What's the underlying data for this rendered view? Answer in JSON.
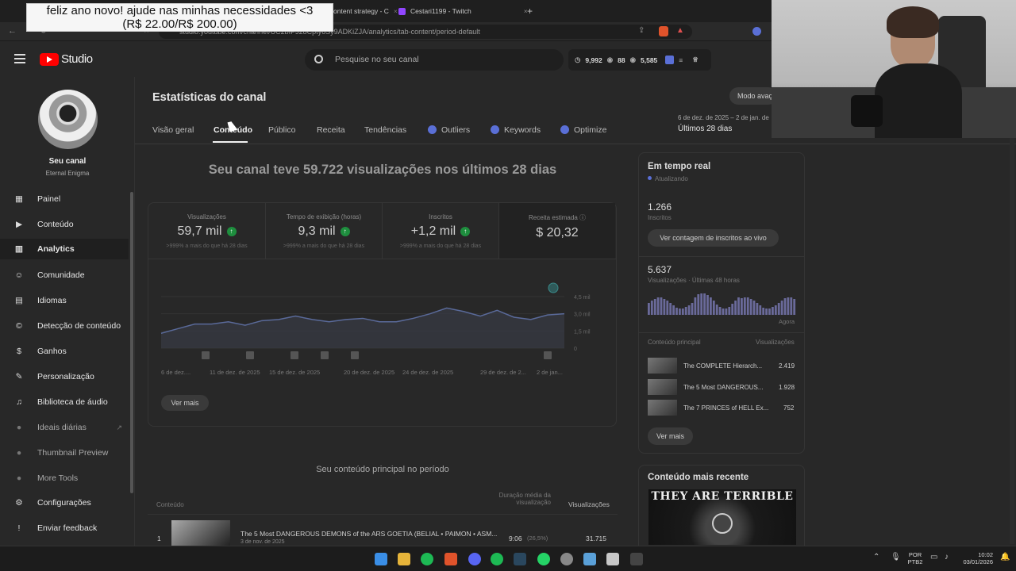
{
  "browser": {
    "tabs": [
      {
        "label": "ontent strategy - C"
      },
      {
        "label": "Cestari1199 - Twitch"
      }
    ],
    "url": "studio.youtube.com/channel/UC2bIPJ28Cpty6Sy9ADKiZJA/analytics/tab-content/period-default"
  },
  "overlay": {
    "donation_line1": "feliz ano novo! ajude nas minhas necessidades <3",
    "donation_line2": "(R$ 22.00/R$ 200.00)"
  },
  "header": {
    "logo_text": "Studio",
    "search_placeholder": "Pesquise no seu canal",
    "stat1": "9,992",
    "stat2": "88",
    "stat3": "5,585"
  },
  "sidebar": {
    "channel_label": "Seu canal",
    "channel_name": "Eternal Enigma",
    "items": [
      {
        "label": "Painel",
        "icon": "dashboard-icon"
      },
      {
        "label": "Conteúdo",
        "icon": "content-icon"
      },
      {
        "label": "Analytics",
        "icon": "analytics-icon"
      },
      {
        "label": "Comunidade",
        "icon": "community-icon"
      },
      {
        "label": "Idiomas",
        "icon": "subtitles-icon"
      },
      {
        "label": "Detecção de conteúdo",
        "icon": "copyright-icon"
      },
      {
        "label": "Ganhos",
        "icon": "dollar-icon"
      },
      {
        "label": "Personalização",
        "icon": "customize-icon"
      },
      {
        "label": "Biblioteca de áudio",
        "icon": "audio-icon"
      },
      {
        "label": "Ideais diárias",
        "icon": "extension-icon"
      },
      {
        "label": "Thumbnail Preview",
        "icon": "extension-icon"
      },
      {
        "label": "More Tools",
        "icon": "extension-icon"
      }
    ],
    "footer": [
      {
        "label": "Configurações",
        "icon": "gear-icon"
      },
      {
        "label": "Enviar feedback",
        "icon": "feedback-icon"
      }
    ]
  },
  "main": {
    "title": "Estatísticas do canal",
    "mode_button": "Modo avaç",
    "date_range": "6 de dez. de 2025 – 2 de jan. de",
    "period_label": "Últimos 28 dias",
    "tabs": [
      "Visão geral",
      "Conteúdo",
      "Público",
      "Receita",
      "Tendências",
      "Outliers",
      "Keywords",
      "Optimize"
    ],
    "headline": "Seu canal teve 59.722 visualizações nos últimos 28 dias",
    "metrics": [
      {
        "label": "Visualizações",
        "value": "59,7 mil",
        "sub": ">999% a mais do que há 28 dias"
      },
      {
        "label": "Tempo de exibição (horas)",
        "value": "9,3 mil",
        "sub": ">999% a mais do que há 28 dias"
      },
      {
        "label": "Inscritos",
        "value": "+1,2 mil",
        "sub": ">999% a mais do que há 28 dias"
      },
      {
        "label": "Receita estimada",
        "value": "$ 20,32",
        "sub": ""
      }
    ],
    "chart_ylabels": [
      "4,5 mil",
      "3,0 mil",
      "1,5 mil",
      "0"
    ],
    "chart_xlabels": [
      "6 de dez....",
      "11 de dez. de 2025",
      "15 de dez. de 2025",
      "20 de dez. de 2025",
      "24 de dez. de 2025",
      "29 de dez. de 2...",
      "2 de jan..."
    ],
    "see_more": "Ver mais",
    "top_content_title": "Seu conteúdo principal no período",
    "table_headers": {
      "content": "Conteúdo",
      "avg": "Duração média da visualização",
      "views": "Visualizações"
    },
    "table_rows": [
      {
        "rank": "1",
        "title": "The 5 Most DANGEROUS DEMONS of the ARS GOETIA (BELIAL • PAIMON • ASM...",
        "date": "3 de nov. de 2025",
        "avg": "9:06",
        "avg_pct": "(26,5%)",
        "views": "31.715"
      }
    ]
  },
  "chart_data": {
    "type": "line",
    "x": [
      "6 de dez.",
      "11 de dez. de 2025",
      "15 de dez. de 2025",
      "20 de dez. de 2025",
      "24 de dez. de 2025",
      "29 de dez. de 2025",
      "2 de jan."
    ],
    "series": [
      {
        "values": [
          1300,
          1700,
          2100,
          2100,
          2300,
          2000,
          2400,
          2500,
          2800,
          2500,
          2300,
          2500,
          2600,
          2300,
          2300,
          2600,
          3000,
          3500,
          3200,
          2800,
          3300,
          2700,
          2500,
          2900,
          3000
        ]
      }
    ],
    "ylim": [
      0,
      4500
    ]
  },
  "realtime": {
    "title": "Em tempo real",
    "status": "Atualizando",
    "subs_value": "1.266",
    "subs_label": "Inscritos",
    "subs_button": "Ver contagem de inscritos ao vivo",
    "views_value": "5.637",
    "views_label": "Visualizações · Últimas 48 horas",
    "now_label": "Agora",
    "top_header": "Conteúdo principal",
    "top_views_header": "Visualizações",
    "top_items": [
      {
        "title": "The COMPLETE Hierarch...",
        "views": "2.419"
      },
      {
        "title": "The 5 Most DANGEROUS...",
        "views": "1.928"
      },
      {
        "title": "The 7 PRINCES of HELL Ex...",
        "views": "752"
      }
    ],
    "see_more": "Ver mais",
    "recent_title": "Conteúdo mais recente",
    "recent_thumb_text": "THEY ARE TERRIBLE"
  },
  "taskbar": {
    "lang": "POR",
    "lang2": "PTB2",
    "time": "10:02",
    "date": "03/01/2026"
  }
}
